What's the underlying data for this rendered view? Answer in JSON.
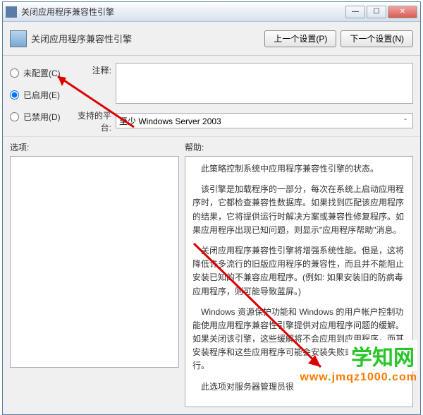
{
  "window": {
    "title": "关闭应用程序兼容性引擎"
  },
  "toolbar": {
    "title": "关闭应用程序兼容性引擎",
    "prev": "上一个设置(P)",
    "next": "下一个设置(N)"
  },
  "radios": {
    "not_configured": "未配置(C)",
    "enabled": "已启用(E)",
    "disabled": "已禁用(D)"
  },
  "fields": {
    "comment_label": "注释:",
    "comment_value": "",
    "platform_label": "支持的平台:",
    "platform_value": "至少 Windows Server 2003"
  },
  "lower": {
    "options_label": "选项:",
    "help_label": "帮助:"
  },
  "help": {
    "p1": "此策略控制系统中应用程序兼容性引擎的状态。",
    "p2": "该引擎是加载程序的一部分，每次在系统上启动应用程序时，它都检查兼容性数据库。如果找到匹配该应用程序的结果，它将提供运行时解决方案或兼容性修复程序。如果应用程序出现已知问题，则显示\"应用程序帮助\"消息。",
    "p3": "关闭应用程序兼容性引擎将增强系统性能。但是，这将降低许多流行的旧版应用程序的兼容性，而且并不能阻止安装已知的不兼容应用程序。(例如: 如果安装旧的防病毒应用程序，则可能导致蓝屏。)",
    "p4": "Windows 资源保护功能和 Windows 的用户帐户控制功能使用应用程序兼容性引擎提供对应用程序问题的缓解。如果关闭该引擎，这些缓解将不会应用到应用程序，而其安装程序和这些应用程序可能会安装失败或无法正常运行。",
    "p5": "此选项对服务器管理员很"
  },
  "watermark": {
    "brand": "学知网",
    "url_pre": "www",
    "url_mid": "jmqz1000",
    "url_suf": "com"
  }
}
